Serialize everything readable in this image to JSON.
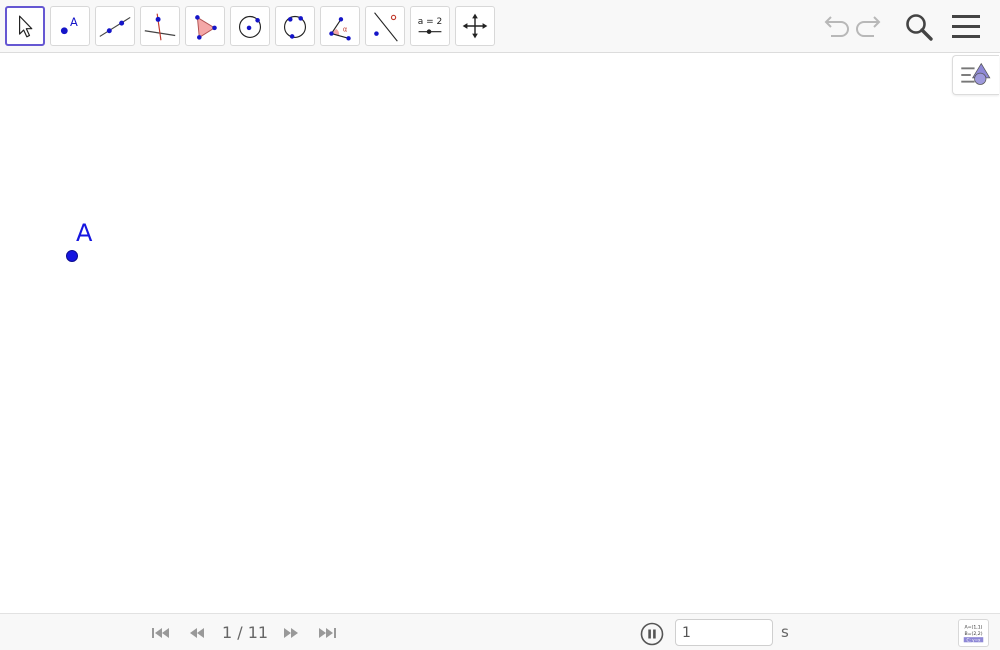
{
  "toolbar": {
    "tools": [
      {
        "name": "Move",
        "icon": "arrow-cursor-icon",
        "selected": true
      },
      {
        "name": "Point",
        "icon": "point-icon"
      },
      {
        "name": "Line",
        "icon": "line-icon"
      },
      {
        "name": "Perpendicular Line",
        "icon": "perpendicular-line-icon"
      },
      {
        "name": "Polygon",
        "icon": "polygon-icon"
      },
      {
        "name": "Circle with Center through Point",
        "icon": "circle-center-icon"
      },
      {
        "name": "Circle through 3 Points",
        "icon": "circle-three-points-icon"
      },
      {
        "name": "Angle",
        "icon": "angle-icon"
      },
      {
        "name": "Reflect about Line",
        "icon": "reflect-icon"
      },
      {
        "name": "Slider",
        "icon": "slider-icon",
        "glyph": "a = 2"
      },
      {
        "name": "Move Graphics View",
        "icon": "move-view-icon"
      }
    ],
    "undo_icon": "undo-icon",
    "redo_icon": "redo-icon",
    "search_icon": "search-icon",
    "menu_icon": "hamburger-menu-icon"
  },
  "canvas": {
    "style_bar_icon": "style-bar-icon",
    "point": {
      "label": "A",
      "color": "#1515e0"
    }
  },
  "playback": {
    "step_counter": "1 / 11",
    "speed_value": "1",
    "speed_unit": "s",
    "buttons": [
      "first-step-icon",
      "previous-step-icon",
      "next-step-icon",
      "last-step-icon"
    ],
    "pause_icon": "pause-icon",
    "algebra_icon": "algebra-view-icon",
    "algebra_glyph_lines": [
      "A=(1,1)",
      "B=(2,2)",
      "C: y=x"
    ]
  },
  "colors": {
    "accent": "#6557d2",
    "point": "#1515e0",
    "icon_dark": "#222222",
    "icon_gray": "#7a7a7a",
    "polygon_fill": "#f4a7a7"
  }
}
